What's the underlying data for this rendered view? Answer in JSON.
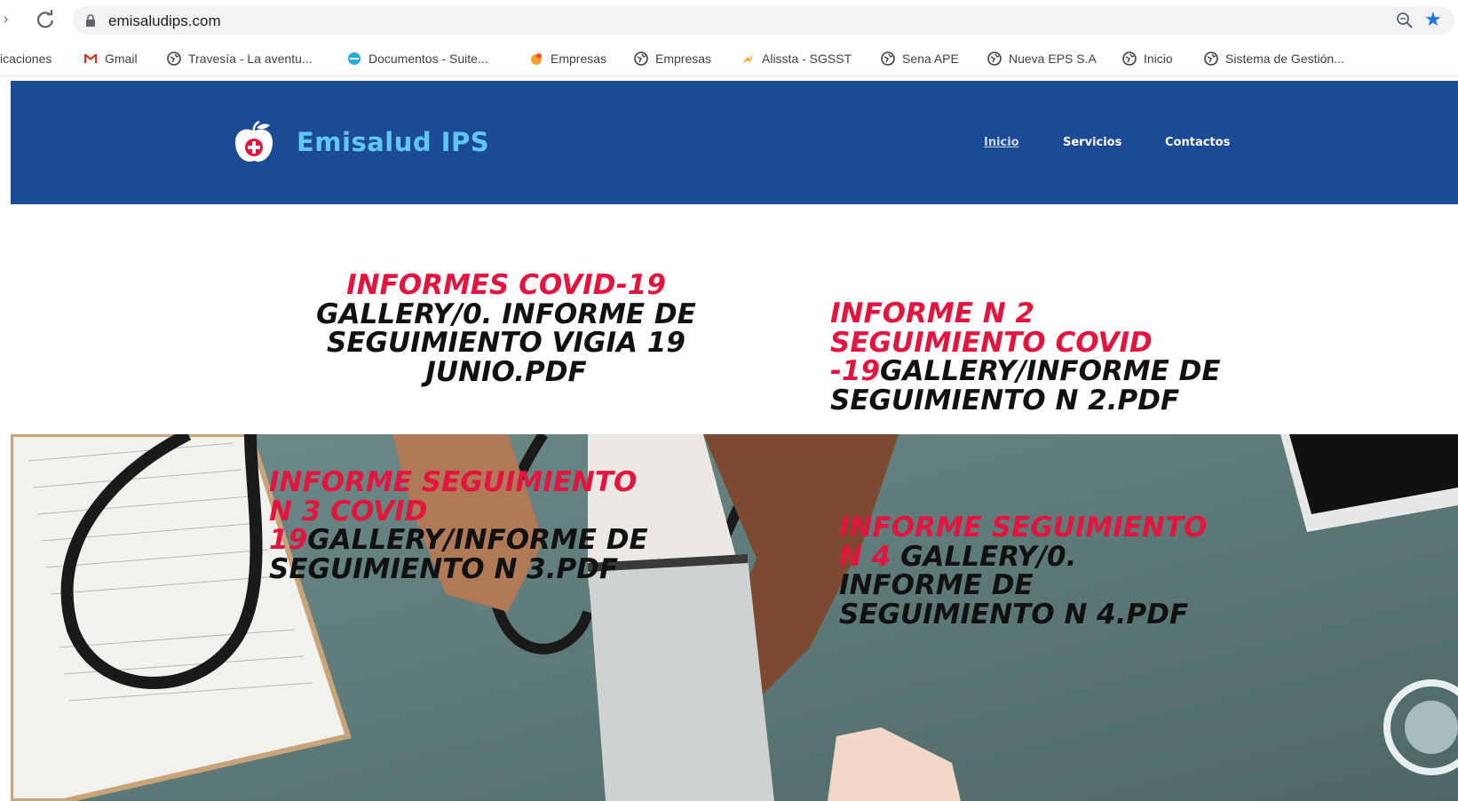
{
  "browser": {
    "url": "emisaludips.com",
    "bookmarks": [
      {
        "label": "icaciones",
        "icon": "apps-icon"
      },
      {
        "label": "Gmail",
        "icon": "gmail-icon"
      },
      {
        "label": "Travesía - La aventu...",
        "icon": "globe-icon"
      },
      {
        "label": "Documentos - Suite...",
        "icon": "docs-icon"
      },
      {
        "label": "Empresas",
        "icon": "empresas-icon"
      },
      {
        "label": "Empresas",
        "icon": "globe-icon"
      },
      {
        "label": "Alissta - SGSST",
        "icon": "alissta-icon"
      },
      {
        "label": "Sena APE",
        "icon": "globe-icon"
      },
      {
        "label": "Nueva EPS S.A",
        "icon": "globe-icon"
      },
      {
        "label": "Inicio",
        "icon": "globe-icon"
      },
      {
        "label": "Sistema de Gestión...",
        "icon": "globe-icon"
      }
    ]
  },
  "site": {
    "brand": "Emisalud IPS",
    "nav": [
      {
        "label": "Inicio",
        "active": true
      },
      {
        "label": "Servicios",
        "active": false
      },
      {
        "label": "Contactos",
        "active": false
      }
    ],
    "colors": {
      "header": "#1d4a95",
      "brand": "#5ec8f2",
      "highlight": "#e3153f"
    }
  },
  "reports": [
    {
      "highlight": "INFORMES COVID-19",
      "text": "GALLERY/0. INFORME DE SEGUIMIENTO VIGIA 19 JUNIO.PDF"
    },
    {
      "highlight": "INFORME N 2 SEGUIMIENTO COVID -19",
      "text": "GALLERY/INFORME DE SEGUIMIENTO N 2.PDF"
    },
    {
      "highlight": "INFORME SEGUIMIENTO N 3 COVID 19",
      "text": "GALLERY/INFORME DE SEGUIMIENTO N 3.PDF"
    },
    {
      "highlight": "INFORME SEGUIMIENTO N 4",
      "text": " GALLERY/0. INFORME DE SEGUIMIENTO N 4.PDF"
    }
  ]
}
